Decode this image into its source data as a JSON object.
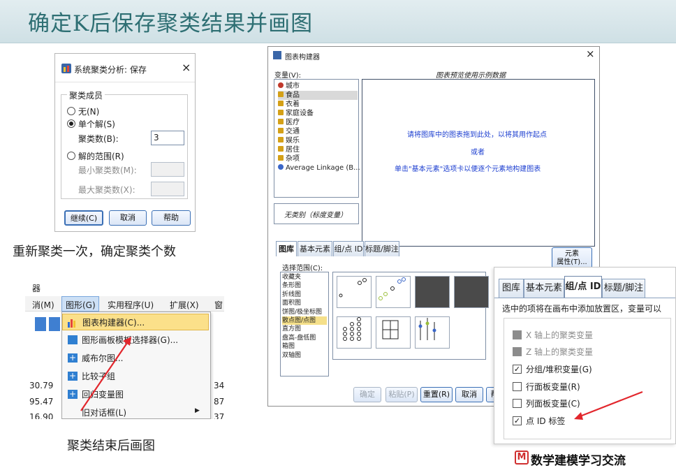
{
  "slide_title": "确定K后保存聚类结果并画图",
  "save_dialog": {
    "title": "系统聚类分析: 保存",
    "group_label": "聚类成员",
    "opt_none": "无(N)",
    "opt_single": "单个解(S)",
    "num_clusters_label": "聚类数(B):",
    "num_clusters_value": "3",
    "opt_range": "解的范围(R)",
    "min_label": "最小聚类数(M):",
    "max_label": "最大聚类数(X):",
    "btn_continue": "继续(C)",
    "btn_cancel": "取消",
    "btn_help": "帮助"
  },
  "caption_recluster": "重新聚类一次，确定聚类个数",
  "menu_shot": {
    "top_left": "器",
    "menubar": [
      "消(M)",
      "图形(G)",
      "实用程序(U)",
      "扩展(X)",
      "窗"
    ],
    "items": [
      "图表构建器(C)...",
      "图形画板模板选择器(G)...",
      "威布尔图...",
      "比较子组",
      "回归变量图",
      "旧对话框(L)"
    ],
    "cells": [
      "30.79",
      "95.47",
      "16.90"
    ],
    "right_cells": [
      "34",
      "87",
      "37"
    ]
  },
  "caption_plot": "聚类结束后画图",
  "chart_builder": {
    "title": "图表构建器",
    "variables_label": "变量(V):",
    "preview_label": "图表预览使用示例数据",
    "variables": [
      "城市",
      "食品",
      "衣着",
      "家庭设备",
      "医疗",
      "交通",
      "娱乐",
      "居住",
      "杂项",
      "Average Linkage (B..."
    ],
    "no_category": "无类别（标度变量）",
    "canvas_lines": [
      "请将图库中的图表拖到此处，以将其用作起点",
      "或者",
      "单击\"基本元素\"选项卡以便逐个元素地构建图表"
    ],
    "tabs": [
      "图库",
      "基本元素",
      "组/点 ID",
      "标题/脚注"
    ],
    "choose_label": "选择范围(C):",
    "gallery_types": [
      "收藏夹",
      "条形图",
      "折线图",
      "面积图",
      "饼图/极坐标图",
      "散点图/点图",
      "直方图",
      "盘高-盘低图",
      "箱图",
      "双轴图"
    ],
    "element_props": "元素\n属性(T)...",
    "bottom_buttons": [
      "确定",
      "粘贴(P)",
      "重置(R)",
      "取消",
      "帮"
    ]
  },
  "zoom_panel": {
    "tabs": [
      "图库",
      "基本元素",
      "组/点 ID",
      "标题/脚注"
    ],
    "hint": "选中的项将在画布中添加放置区，变量可以",
    "options": [
      {
        "label": "X 轴上的聚类变量",
        "state": "disabled"
      },
      {
        "label": "Z 轴上的聚类变量",
        "state": "disabled"
      },
      {
        "label": "分组/堆积变量(G)",
        "state": "checked"
      },
      {
        "label": "行面板变量(R)",
        "state": "unchecked"
      },
      {
        "label": "列面板变量(C)",
        "state": "unchecked"
      },
      {
        "label": "点 ID 标签",
        "state": "checked"
      }
    ]
  },
  "watermark": "数学建模学习交流",
  "colors": {
    "accent_red": "#e2262c",
    "title_teal": "#2e6f73",
    "canvas_blue": "#1d3fd0"
  }
}
